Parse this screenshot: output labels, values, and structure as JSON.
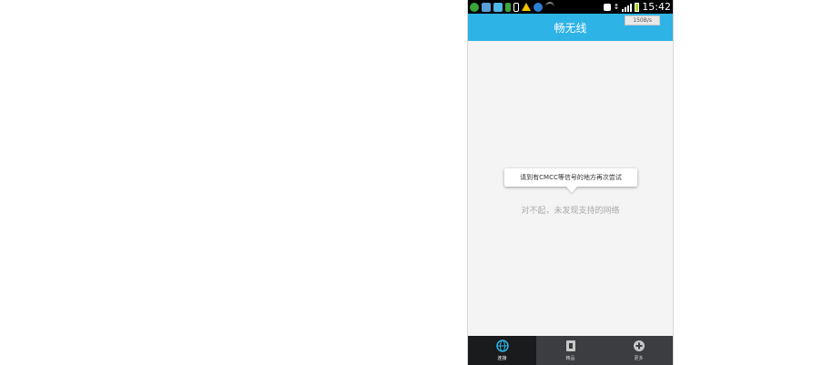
{
  "status_bar": {
    "time": "15:42",
    "battery_color": "#a5d71b",
    "icons": [
      "app-icon",
      "shield-icon",
      "message-icon",
      "download-icon",
      "usb-icon",
      "warning-icon",
      "browser-icon",
      "wifi-icon",
      "sim-icon",
      "network-icon",
      "signal-icon",
      "battery-icon"
    ]
  },
  "header": {
    "title": "畅无线",
    "speed": "150B/s",
    "accent": "#2eb3e6"
  },
  "main": {
    "tooltip": "请到有CMCC等信号的地方再次尝试",
    "message": "对不起，未发现支持的网络"
  },
  "tabbar": {
    "items": [
      {
        "label": "连接",
        "icon": "globe-icon",
        "active": true
      },
      {
        "label": "精品",
        "icon": "app-box-icon",
        "active": false
      },
      {
        "label": "更多",
        "icon": "plus-circle-icon",
        "active": false
      }
    ]
  }
}
